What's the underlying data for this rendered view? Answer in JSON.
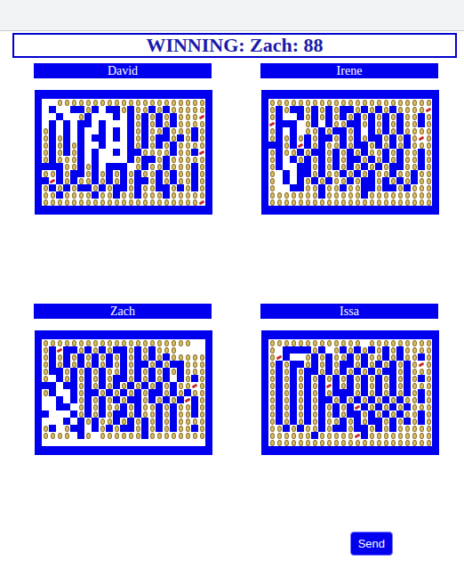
{
  "banner": {
    "text": "WINNING: Zach: 88"
  },
  "boards": [
    {
      "player": "David",
      "grid": [
        "..ooooooooooooooooooooo",
        ".#..##o#.##o#oo#o#ooooo",
        "..#..o#...#.#o#o#o#oooc",
        ".#.#.##.#...#o#o#o#oooo",
        "o#.#.#..#.#.#o#oo#ooo#o",
        "o#o#.#.##.#.#o#o##o#o#o",
        "o#o#o#..#...#o#o#o#oooo",
        "o#o#o#.#..#.##oooo#oo#c",
        "o#ooo#.#....#o##o#ooooo",
        "###oo#o#.###.o#oo#ooo#o",
        "oo#o##o#o#o#o#oo#o#oo#o",
        "#c#o#oo#o#o#o##o#o#oo#o",
        "o#o#o##o#o##o#oo##o#o#o",
        "oo#oooo#oo#oo#ooo#ooooo",
        "ooooooooooooooooooooooc"
      ]
    },
    {
      "player": "Irene",
      "grid": [
        "ooooooooooooooooooooooo",
        "o#o##o#o#o##o#o#o#ooooc",
        "o#..#o#o#o#o#o#o#o#oo#o",
        "c###.o#.#oo##o#o#o#oo#o",
        "o#.#.oo#o##o#.#o#o#oooo",
        "o#o#o#o##o#o#o##o#o#oco",
        "##o#c#o#oo#o##o#o#o#ooo",
        "o#oo#o##o#o#o#oo#o#oo#o",
        "o#.#o#o#o#o##o#o#o#oo#o",
        "o#..##o#o#o#o#o#o##oo#o",
        "o.#.##o#oo#o#o#oo#oo#oo",
        "o.#.#o#o#oo#o##o#o#o#oo",
        "o..##oo#oo#oo##o##o#ooo",
        "ooooooo#ooooo#ooooooooo",
        "ooooooooooooooooooooooo"
      ]
    },
    {
      "player": "Zach",
      "grid": [
        "ooooooooooooooooooooo..",
        "o#c##o#o#o##o#o#ooo....",
        "o#o#o#o#o#o#o#o#o#ooooo",
        "o#o#o#o#o#o#o##o#o##ooo",
        "o##o#o#o#oo#o#o#o#o#ooo",
        "o.#o#o#o#o##o#o#o#.#o#o",
        "##.##o#o#o#o#o#o#o#ooco",
        "o#..#o##o#o#o#o##o#o#oo",
        "..#.#o#o#o#o##o#o#o#c#o",
        "..##.o#o#oo#o#oo#o#oo#o",
        "#...#o#o#o##o#oo#o#oo#o",
        "...#.#o#oo#o#o#o#o#oooo",
        "o#.o##.#o#o##o#o#o#oo#o",
        "oooo.#o.oooooo#oooooooo",
        "......................."
      ]
    },
    {
      "player": "Issa",
      "grid": [
        "ooooooooooooo.ooooooooo",
        "o.####o#.o#o#o#o#o#oooo",
        "oc#..o#o#oo#o#oo#o#oo#o",
        "o#o##o#o#o##o#o#o#o#oco",
        "o#o#o##o#o#o#o#o##o#ooo",
        "o#o#o#o#o#o#o#o#o#o#o#o",
        "o#o#o#o#c#o#o#o#o#o#ooo",
        "o#o#o#o#o###o#o#o#o#o#o",
        "o#o#o#o##o#o#o#o#o#oo#o",
        "o#o#o#o#o#o#c#o#o#o#ooo",
        "o#o#o#o#o#o##o#o#o#oo#o",
        "o#o#o#o#oo#o#o##o#o#o#o",
        "oo#o#oo#o##o##o#o#ooooo",
        "oooooo#oooooc#ooooooooo",
        "ooooooooooooooooooooooo"
      ]
    }
  ],
  "buttons": [
    {
      "label": "Send"
    }
  ]
}
